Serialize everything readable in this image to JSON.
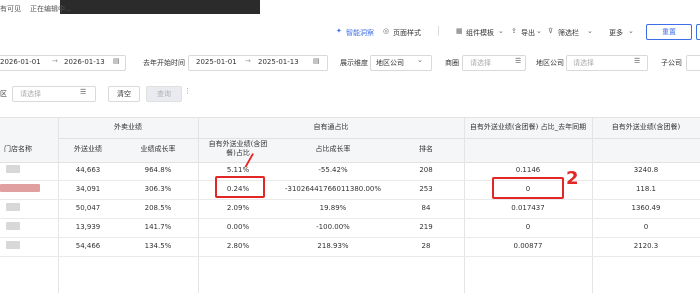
{
  "toolbar": {
    "status_left": "有可见",
    "status_editing": "正在编辑中...",
    "smart_insight": "智能洞察",
    "page_style": "页面样式",
    "component_template": "组件模板",
    "export": "导出",
    "filter": "筛选栏",
    "more": "更多",
    "save_label": "重置"
  },
  "filters": {
    "date_start": "2026-01-01",
    "date_end": "2026-01-13",
    "last_year_label": "去年开始时间",
    "ly_start": "2025-01-01",
    "ly_end": "2025-01-13",
    "dim_label": "展示维度",
    "dim_value": "地区公司",
    "area_label": "商圈",
    "area_placeholder": "请选择",
    "company_label": "地区公司",
    "company_placeholder": "请选择",
    "sub_company_label": "子公司",
    "region_label": "区",
    "region_placeholder": "请选择",
    "clear_button": "清空",
    "query_button": "查询"
  },
  "table": {
    "group_headers": [
      "外卖业绩",
      "自有通占比",
      "自有外送业绩(含团餐) 占比_去年同期",
      "自有外送业绩(含团餐)"
    ],
    "columns": [
      "门店名称",
      "外送业绩",
      "业绩成长率",
      "自有外送业绩(含团餐)占比",
      "占比成长率",
      "排名",
      "",
      ""
    ],
    "rows": [
      [
        "44,663",
        "964.8%",
        "5.11%",
        "-55.42%",
        "208",
        "0.1146",
        "3240.8"
      ],
      [
        "34,091",
        "306.3%",
        "0.24%",
        "-31026441766011380.00%",
        "253",
        "0",
        "118.1"
      ],
      [
        "50,047",
        "208.5%",
        "2.09%",
        "19.89%",
        "84",
        "0.017437",
        "1360.49"
      ],
      [
        "13,939",
        "141.7%",
        "0.00%",
        "-100.00%",
        "219",
        "0",
        "0"
      ],
      [
        "54,466",
        "134.5%",
        "2.80%",
        "218.93%",
        "28",
        "0.00877",
        "2120.3"
      ]
    ]
  },
  "annotations": {
    "mark_1": "/",
    "mark_2": "2"
  },
  "colors": {
    "accent": "#3d6ee8",
    "annotation_red": "#e32727",
    "header_bg": "#f5f6f8"
  }
}
